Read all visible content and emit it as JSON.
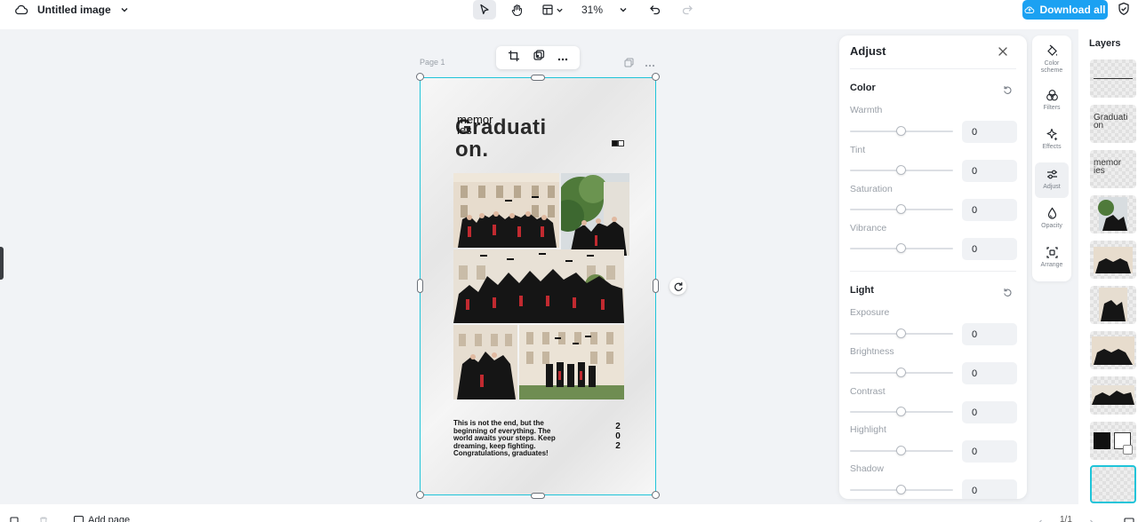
{
  "header": {
    "title": "Untitled image",
    "zoom": "31%",
    "download_label": "Download all"
  },
  "canvas": {
    "page_label": "Page 1",
    "art": {
      "title_line1": "Graduati",
      "title_line2": "on.",
      "overlay_text": "memor",
      "overlay_text2": "ies",
      "body_text": "This is not the end, but the beginning of everything. The world awaits your steps. Keep dreaming, keep fighting. Congratulations, graduates!",
      "year_vertical": "202"
    }
  },
  "adjust": {
    "title": "Adjust",
    "color_section": {
      "title": "Color",
      "sliders": [
        {
          "label": "Warmth",
          "value": "0"
        },
        {
          "label": "Tint",
          "value": "0"
        },
        {
          "label": "Saturation",
          "value": "0"
        },
        {
          "label": "Vibrance",
          "value": "0"
        }
      ]
    },
    "light_section": {
      "title": "Light",
      "sliders": [
        {
          "label": "Exposure",
          "value": "0"
        },
        {
          "label": "Brightness",
          "value": "0"
        },
        {
          "label": "Contrast",
          "value": "0"
        },
        {
          "label": "Highlight",
          "value": "0"
        },
        {
          "label": "Shadow",
          "value": "0"
        }
      ]
    }
  },
  "tool_strip": {
    "items": [
      {
        "label": "Color scheme",
        "icon": "paint-bucket-icon"
      },
      {
        "label": "Filters",
        "icon": "filters-icon"
      },
      {
        "label": "Effects",
        "icon": "sparkle-icon"
      },
      {
        "label": "Adjust",
        "icon": "sliders-icon"
      },
      {
        "label": "Opacity",
        "icon": "droplet-icon"
      },
      {
        "label": "Arrange",
        "icon": "arrange-icon"
      }
    ],
    "active": "Adjust"
  },
  "layers": {
    "title": "Layers",
    "thumb_text_1": "Graduati",
    "thumb_text_1b": "on",
    "thumb_text_2": "memor",
    "thumb_text_2b": "ies"
  },
  "bottom": {
    "add_page_label": "Add page",
    "page_count": "1/1"
  },
  "colors": {
    "accent": "#1ba1f2",
    "selection": "#1fc4d9"
  }
}
